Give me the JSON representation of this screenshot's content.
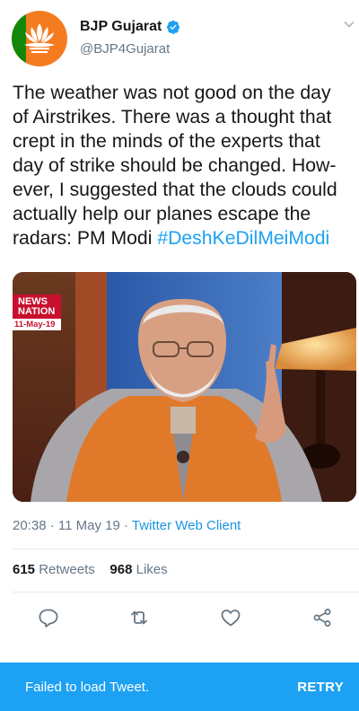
{
  "tweet": {
    "display_name": "BJP Gujarat",
    "handle": "@BJP4Gujarat",
    "verified": true,
    "text_lines": [
      "The weather was not good on the day",
      "of Airstrikes. There was a thought that",
      "crept in the minds of the experts that",
      "day of strike should be changed. How-",
      "ever, I suggested that the clouds could",
      "actually help our planes escape the",
      "radars: PM Modi "
    ],
    "hashtag": "#DeshKeDilMeiModi",
    "media": {
      "badge_label_line1": "NEWS",
      "badge_label_line2": "NATION",
      "badge_date": "11-May-19"
    },
    "time": "20:38",
    "separator": "·",
    "date": "11 May 19",
    "client": "Twitter Web Client",
    "retweets_count": "615",
    "retweets_label": "Retweets",
    "likes_count": "968",
    "likes_label": "Likes"
  },
  "actions": [
    "reply-icon",
    "retweet-icon",
    "like-icon",
    "share-icon"
  ],
  "error_bar": {
    "message": "Failed to load Tweet.",
    "retry_label": "RETRY"
  },
  "colors": {
    "accent": "#1da1f2",
    "link": "#1b95e0",
    "secondary_text": "#657786",
    "primary_text": "#14171a"
  }
}
